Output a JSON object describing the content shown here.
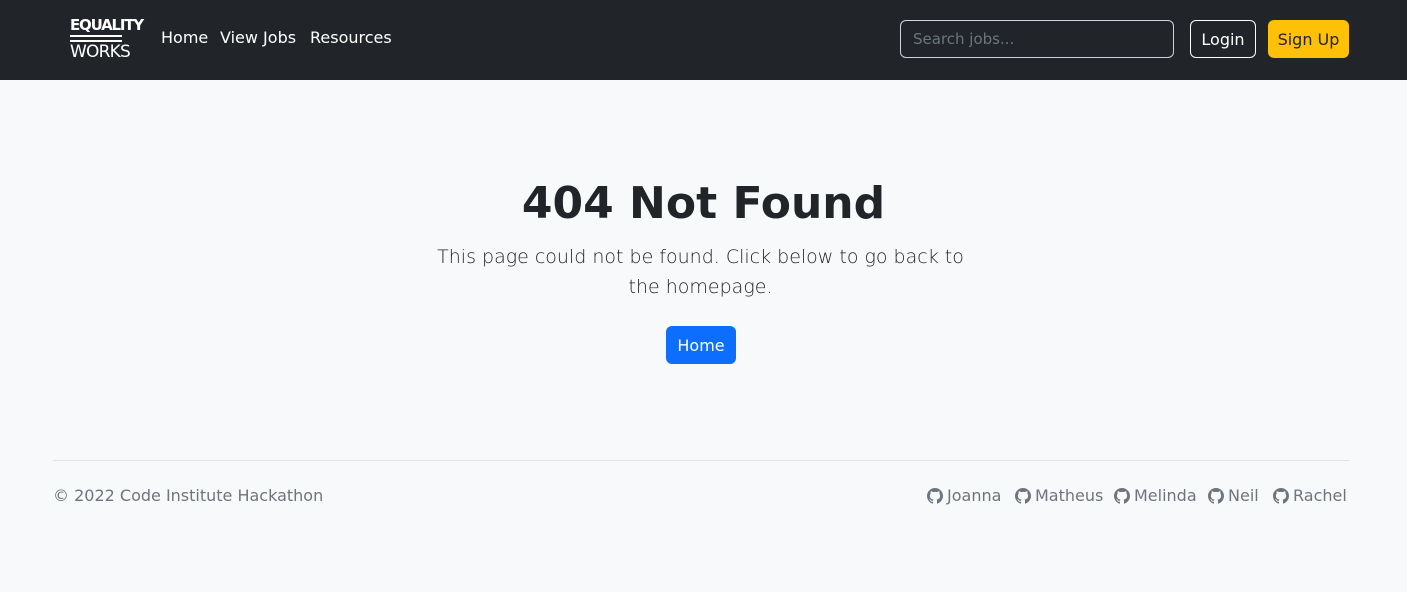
{
  "brand": {
    "line1": "EQUALITY",
    "line2": "WORKS"
  },
  "nav": {
    "items": [
      {
        "label": "Home"
      },
      {
        "label": "View Jobs"
      },
      {
        "label": "Resources"
      }
    ]
  },
  "search": {
    "placeholder": "Search jobs...",
    "value": ""
  },
  "auth": {
    "login_label": "Login",
    "signup_label": "Sign Up"
  },
  "main": {
    "title": "404 Not Found",
    "message": "This page could not be found. Click below to go back to the homepage.",
    "button_label": "Home"
  },
  "footer": {
    "copyright": "© 2022 Code Institute Hackathon",
    "contributors": [
      {
        "name": "Joanna",
        "icon": "github-icon"
      },
      {
        "name": "Matheus",
        "icon": "github-icon"
      },
      {
        "name": "Melinda",
        "icon": "github-icon"
      },
      {
        "name": "Neil",
        "icon": "github-icon"
      },
      {
        "name": "Rachel",
        "icon": "github-icon"
      }
    ]
  },
  "colors": {
    "navbar_bg": "#212529",
    "page_bg": "#f8f9fa",
    "primary": "#0d6efd",
    "warning": "#ffc107",
    "muted_text": "#6c757d"
  }
}
